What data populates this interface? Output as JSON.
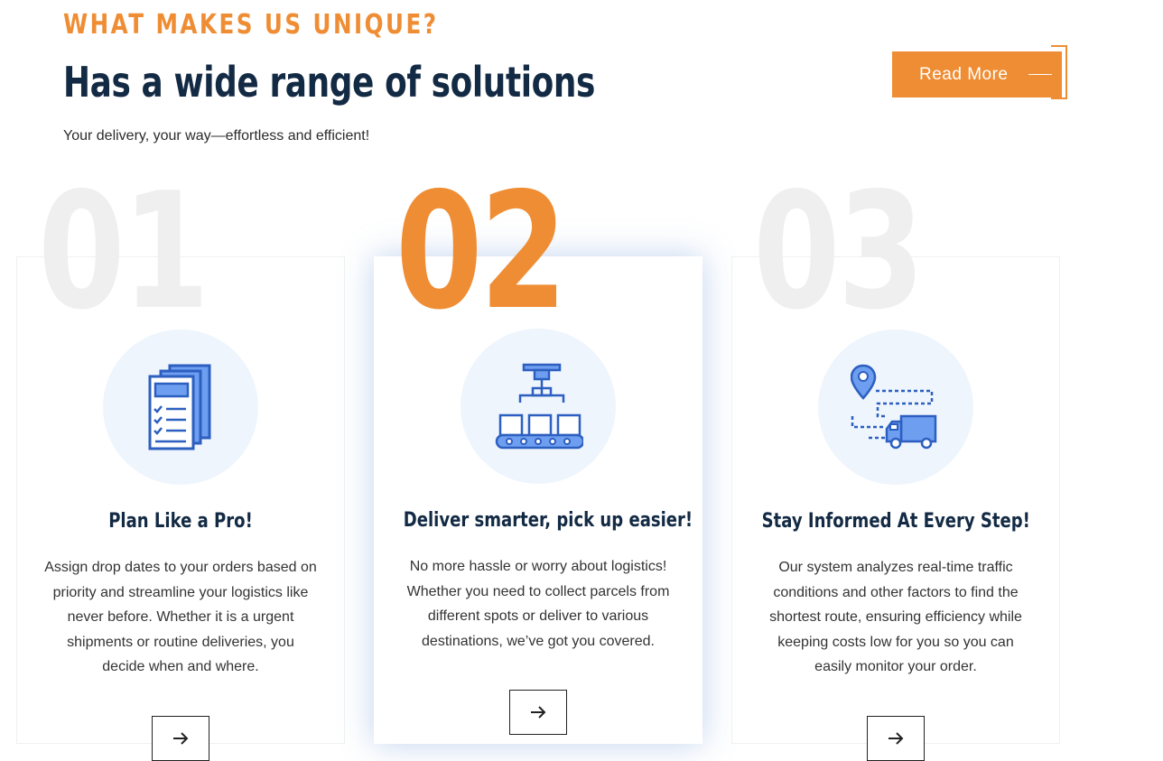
{
  "header": {
    "kicker": "WHAT MAKES US UNIQUE?",
    "title": "Has a wide range of solutions",
    "subtitle": "Your delivery, your way—effortless and efficient!",
    "read_more_label": "Read More"
  },
  "colors": {
    "accent": "#ef8d34",
    "heading": "#132a44",
    "icon_blue": "#2c5fc0",
    "icon_fill": "#6e9ef0",
    "icon_bg": "#eef5fd"
  },
  "cards": [
    {
      "number": "01",
      "icon": "documents-checklist-icon",
      "title": "Plan Like a Pro!",
      "text": "Assign drop dates to your orders based on priority and streamline your logistics like never before. Whether it is a urgent shipments or routine deliveries, you decide when and where.",
      "active": false
    },
    {
      "number": "02",
      "icon": "conveyor-belt-icon",
      "title": "Deliver smarter, pick up easier!",
      "text": "No more hassle or worry about logistics! Whether you need to collect parcels from different spots or deliver to various destinations, we’ve got you covered.",
      "active": true
    },
    {
      "number": "03",
      "icon": "delivery-truck-route-icon",
      "title": "Stay Informed At Every Step!",
      "text": "Our system analyzes real-time traffic conditions and other factors to find the shortest route, ensuring efficiency while keeping costs low for you so you can easily monitor your order.",
      "active": false
    }
  ]
}
